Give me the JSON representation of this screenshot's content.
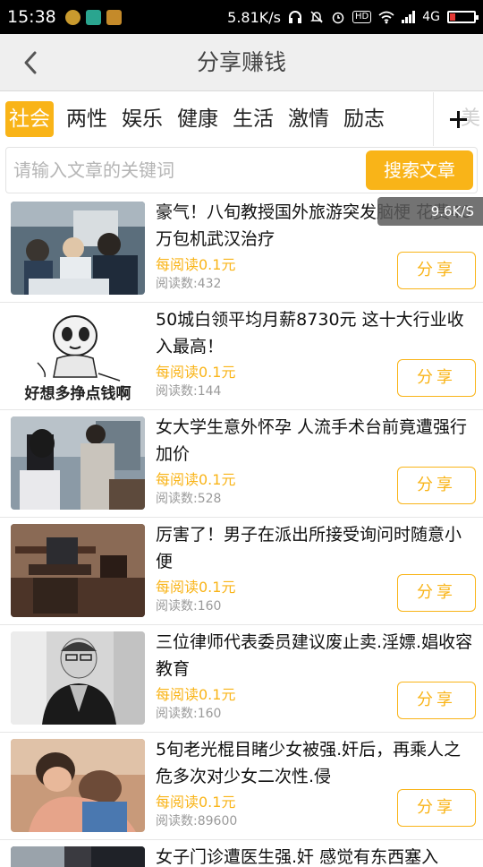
{
  "status": {
    "time": "15:38",
    "speed": "5.81K/s",
    "hd": "HD",
    "network": "4G"
  },
  "nav": {
    "title": "分享赚钱"
  },
  "tabs": [
    {
      "label": "社会"
    },
    {
      "label": "两性"
    },
    {
      "label": "娱乐"
    },
    {
      "label": "健康"
    },
    {
      "label": "生活"
    },
    {
      "label": "激情"
    },
    {
      "label": "励志"
    }
  ],
  "tab_more_ghost": "美",
  "search": {
    "placeholder": "请输入文章的关键词",
    "button_label": "搜索文章"
  },
  "overlay_speed": "9.6K/S",
  "articles": [
    {
      "title": "豪气！八旬教授国外旅游突发脑梗 花费40万包机武汉治疗",
      "reward": "每阅读0.1元",
      "reads": "阅读数:432",
      "share": "分享"
    },
    {
      "title": "50城白领平均月薪8730元 这十大行业收入最高！",
      "reward": "每阅读0.1元",
      "reads": "阅读数:144",
      "share": "分享",
      "thumb_caption": "好想多挣点钱啊"
    },
    {
      "title": "女大学生意外怀孕 人流手术台前竟遭强行加价",
      "reward": "每阅读0.1元",
      "reads": "阅读数:528",
      "share": "分享"
    },
    {
      "title": "厉害了！男子在派出所接受询问时随意小便",
      "reward": "每阅读0.1元",
      "reads": "阅读数:160",
      "share": "分享"
    },
    {
      "title": "三位律师代表委员建议废止卖.淫嫖.娼收容教育",
      "reward": "每阅读0.1元",
      "reads": "阅读数:160",
      "share": "分享"
    },
    {
      "title": "5旬老光棍目睹少女被强.奸后，再乘人之危多次对少女二次性.侵",
      "reward": "每阅读0.1元",
      "reads": "阅读数:89600",
      "share": "分享"
    },
    {
      "title": "女子门诊遭医生强.奸 感觉有东西塞入"
    }
  ],
  "colors": {
    "accent": "#f9b418",
    "nav_bg": "#efefef",
    "status_bg": "#000000"
  },
  "icons": {
    "back": "chevron-left-icon",
    "more_tabs": "plus-icon"
  }
}
